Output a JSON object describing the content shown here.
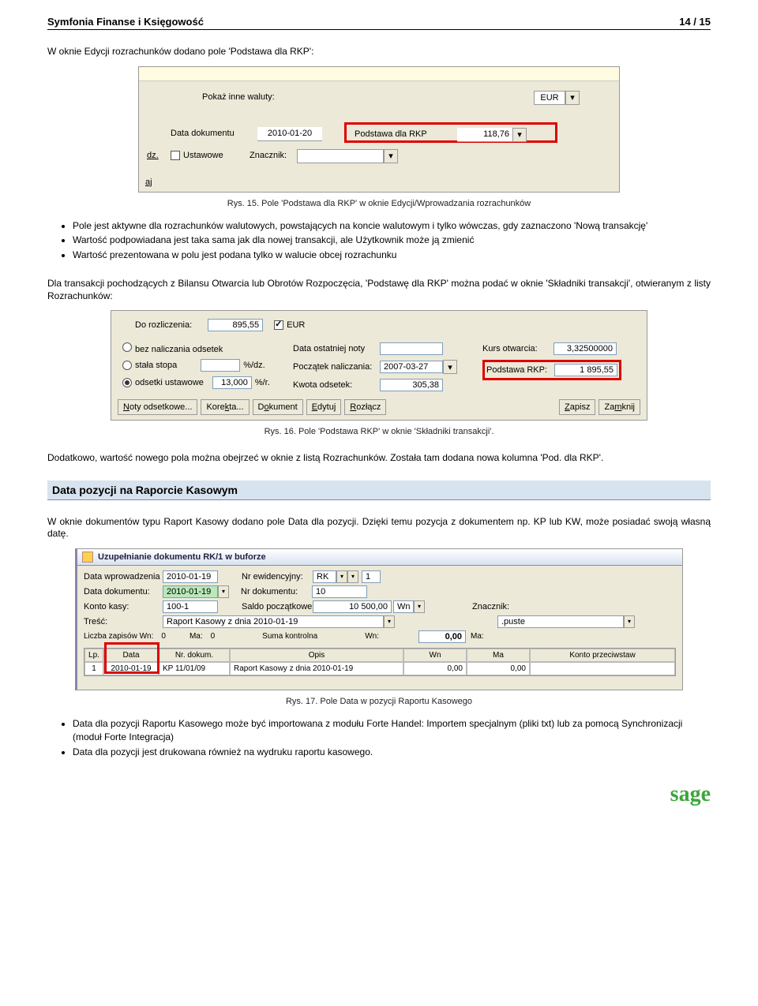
{
  "header": {
    "title": "Symfonia Finanse i Księgowość",
    "page": "14 / 15"
  },
  "para1": "W oknie Edycji rozrachunków dodano pole 'Podstawa dla RKP':",
  "shot1": {
    "pokazInne": "Pokaż inne waluty:",
    "eur": "EUR",
    "dataDokLabel": "Data dokumentu",
    "dataDokValue": "2010-01-20",
    "podstawaLabel": "Podstawa dla RKP",
    "podstawaValue": "118,76",
    "dz": "dz.",
    "ustawowe": "Ustawowe",
    "znacznik": "Znacznik:",
    "bottom": "aj"
  },
  "caption1": "Rys. 15. Pole 'Podstawa dla RKP' w oknie Edycji/Wprowadzania rozrachunków",
  "bullets1": [
    "Pole jest aktywne dla rozrachunków walutowych, powstających na koncie walutowym i tylko wówczas, gdy zaznaczono 'Nową transakcję'",
    "Wartość podpowiadana jest taka sama jak dla nowej transakcji, ale Użytkownik może ją zmienić",
    "Wartość prezentowana w polu jest podana tylko w walucie obcej rozrachunku"
  ],
  "para2": "Dla transakcji pochodzących z Bilansu Otwarcia lub Obrotów Rozpoczęcia, 'Podstawę dla RKP' można podać w oknie 'Składniki transakcji', otwieranym z listy Rozrachunków:",
  "shot2": {
    "doRozl": "Do rozliczenia:",
    "doRozlVal": "895,55",
    "eur": "EUR",
    "r1": "bez naliczania odsetek",
    "r2": "stała stopa",
    "r3": "odsetki ustawowe",
    "pcDz": "%/dz.",
    "pcR": "%/r.",
    "pcRVal": "13,000",
    "dataOst": "Data ostatniej noty",
    "poczNal": "Początek naliczania:",
    "poczNalVal": "2007-03-27",
    "kwotaOds": "Kwota odsetek:",
    "kwotaOdsVal": "305,38",
    "kursOtw": "Kurs otwarcia:",
    "kursOtwVal": "3,32500000",
    "podstawa": "Podstawa RKP:",
    "podstawaVal": "1 895,55",
    "btns": [
      "Noty odsetkowe...",
      "Korekta...",
      "Dokument",
      "Edytuj",
      "Rozłącz",
      "Zapisz",
      "Zamknij"
    ]
  },
  "caption2": "Rys. 16. Pole 'Podstawa RKP' w oknie 'Składniki transakcji'.",
  "para3": "Dodatkowo, wartość nowego pola można obejrzeć w oknie z listą Rozrachunków. Została tam dodana nowa kolumna 'Pod. dla RKP'.",
  "section": "Data pozycji na Raporcie Kasowym",
  "para4": "W oknie dokumentów typu Raport Kasowy dodano pole Data dla pozycji. Dzięki temu pozycja z dokumentem np. KP lub KW, może posiadać swoją własną datę.",
  "shot3": {
    "title": "Uzupełnianie dokumentu RK/1 w buforze",
    "dataWprow": "Data wprowadzenia",
    "dataWprowVal": "2010-01-19",
    "dataDok": "Data dokumentu:",
    "dataDokVal": "2010-01-19",
    "kontoKasy": "Konto kasy:",
    "kontoKasyVal": "100-1",
    "tresc": "Treść:",
    "trescVal": "Raport Kasowy z dnia 2010-01-19",
    "nrEw": "Nr ewidencyjny:",
    "nrEwSel": "RK",
    "nrEwNum": "1",
    "nrDok": "Nr dokumentu:",
    "nrDokVal": "10",
    "saldoPocz": "Saldo początkowe:",
    "saldoPoczVal": "10 500,00",
    "wn": "Wn",
    "znacznik": "Znacznik:",
    "znacznikVal": ".puste",
    "liczba": "Liczba zapisów Wn:",
    "liczbaVal": "0",
    "ma": "Ma:",
    "maVal": "0",
    "sumaK": "Suma kontrolna",
    "sumaWn": "Wn:",
    "sumaWnVal": "0,00",
    "sumaMa": "Ma:",
    "cols": [
      "Lp.",
      "Data",
      "Nr. dokum.",
      "Opis",
      "Wn",
      "Ma",
      "Konto przeciwstaw"
    ],
    "row": [
      "1",
      "2010-01-19",
      "KP 11/01/09",
      "Raport Kasowy z dnia 2010-01-19",
      "0,00",
      "0,00",
      ""
    ]
  },
  "caption3": "Rys. 17. Pole Data w pozycji Raportu Kasowego",
  "bullets2": [
    "Data dla pozycji Raportu Kasowego może być importowana z modułu Forte Handel: Importem specjalnym (pliki txt) lub za pomocą Synchronizacji (moduł Forte Integracja)",
    "Data dla pozycji jest drukowana również na wydruku raportu kasowego."
  ],
  "logo": "sage"
}
